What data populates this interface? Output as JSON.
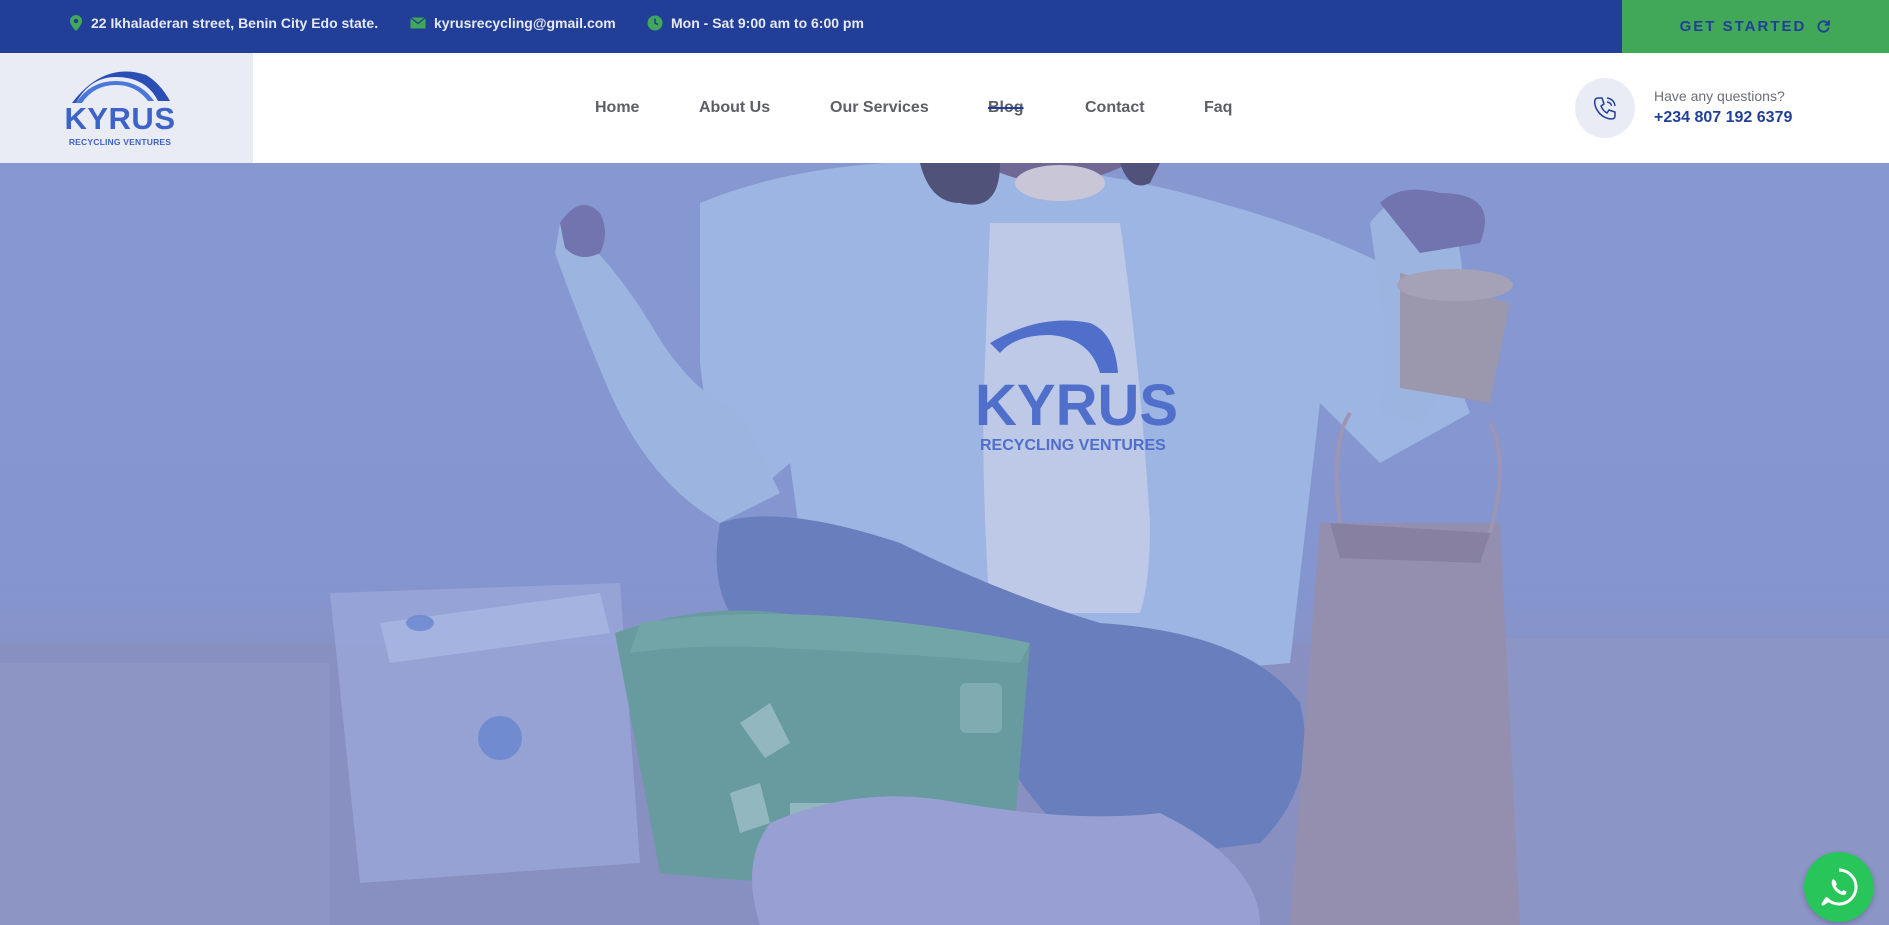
{
  "topbar": {
    "address": "22 Ikhaladeran street, Benin City Edo state.",
    "email": "kyrusrecycling@gmail.com",
    "hours": "Mon - Sat 9:00 am to 6:00 pm",
    "cta_label": "GET STARTED",
    "cta_icon": "refresh-icon"
  },
  "logo": {
    "word": "KYRUS",
    "subtitle": "RECYCLING VENTURES"
  },
  "nav": {
    "items": [
      {
        "label": "Home"
      },
      {
        "label": "About Us"
      },
      {
        "label": "Our Services"
      },
      {
        "label": "Blog"
      },
      {
        "label": "Contact"
      },
      {
        "label": "Faq"
      }
    ]
  },
  "contact": {
    "question": "Have any questions?",
    "phone": "+234 807 192 6379",
    "icon": "phone-icon"
  },
  "hero": {
    "shirt_logo_word": "KYRUS",
    "shirt_logo_sub": "RECYCLING VENTURES"
  },
  "floating": {
    "icon": "whatsapp-icon"
  },
  "colors": {
    "primary_blue": "#213f99",
    "accent_green": "#41a857",
    "whatsapp_green": "#28c65a",
    "logo_blue": "#3d63c9"
  }
}
